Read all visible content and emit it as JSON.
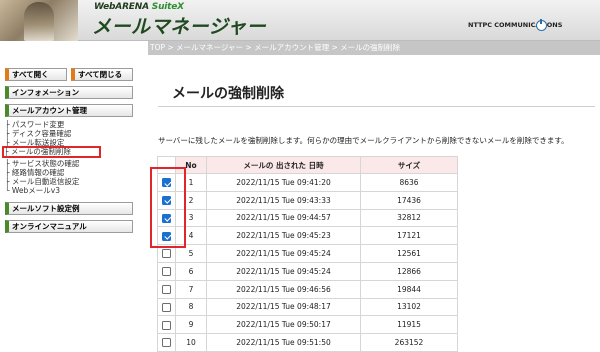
{
  "header": {
    "brand_line": "WebARENA",
    "brand_suite": "SuiteX",
    "app_title": "メールマネージャー",
    "ntt_logo": "NTTPC COMMUNICATIONS"
  },
  "breadcrumb": "TOP > メールマネージャー > メールアカウント管理 > メールの強制削除",
  "sidebar": {
    "open_all": "すべて開く",
    "close_all": "すべて閉じる",
    "information": "インフォメーション",
    "account_mgmt": "メールアカウント管理",
    "items": [
      "├ パスワード変更",
      "├ ディスク容量確認",
      "├ メール転送設定",
      "├ メールの強制削除",
      "├ サービス状態の確認",
      "├ 経路情報の確認",
      "├ メール自動返信設定",
      "└ Webメールv3"
    ],
    "software": "メールソフト設定例",
    "manual": "オンラインマニュアル"
  },
  "main": {
    "title": "メールの強制削除",
    "description": "サーバーに残したメールを強制削除します。何らかの理由でメールクライアントから削除できないメールを削除できます。",
    "table": {
      "headers": [
        "No",
        "メールの 出された 日時",
        "サイズ"
      ],
      "rows": [
        {
          "checked": true,
          "no": "1",
          "date": "2022/11/15 Tue 09:41:20",
          "size": "8636"
        },
        {
          "checked": true,
          "no": "2",
          "date": "2022/11/15 Tue 09:43:33",
          "size": "17436"
        },
        {
          "checked": true,
          "no": "3",
          "date": "2022/11/15 Tue 09:44:57",
          "size": "32812"
        },
        {
          "checked": true,
          "no": "4",
          "date": "2022/11/15 Tue 09:45:23",
          "size": "17121"
        },
        {
          "checked": false,
          "no": "5",
          "date": "2022/11/15 Tue 09:45:24",
          "size": "12561"
        },
        {
          "checked": false,
          "no": "6",
          "date": "2022/11/15 Tue 09:45:24",
          "size": "12866"
        },
        {
          "checked": false,
          "no": "7",
          "date": "2022/11/15 Tue 09:46:56",
          "size": "19844"
        },
        {
          "checked": false,
          "no": "8",
          "date": "2022/11/15 Tue 09:48:17",
          "size": "13102"
        },
        {
          "checked": false,
          "no": "9",
          "date": "2022/11/15 Tue 09:50:17",
          "size": "11915"
        },
        {
          "checked": false,
          "no": "10",
          "date": "2022/11/15 Tue 09:51:50",
          "size": "263152"
        }
      ]
    }
  },
  "colors": {
    "accent_orange": "#e07a1a",
    "accent_green": "#4a8a2a",
    "highlight_red": "#e0262a",
    "checkbox_blue": "#1a6fd0",
    "header_cell_pink": "#fbe9e9",
    "breadcrumb_gray": "#c6c6c6"
  }
}
